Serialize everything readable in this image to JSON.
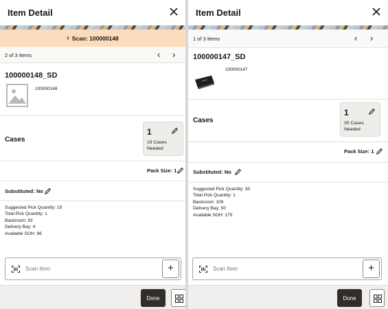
{
  "left": {
    "title": "Item Detail",
    "scan_banner": "Scan: 100000148",
    "pager_text": "2 of 3 Items",
    "item_id": "100000148_SD",
    "upc": "100000148",
    "uom_label": "Cases",
    "qty_value": "1",
    "qty_needed": "19 Cases Needed",
    "pack_size": "Pack Size: 1",
    "substituted": "Substituted: No",
    "details": [
      "Suggested Pick Quantity: 19",
      "Total Pick Quantity: 1",
      "Backroom: 83",
      "Delivery Bay: 4",
      "Available SOH: 96"
    ],
    "scan_placeholder": "Scan Item",
    "done_label": "Done"
  },
  "right": {
    "title": "Item Detail",
    "pager_text": "1 of 3 Items",
    "item_id": "100000147_SD",
    "upc": "100000147",
    "uom_label": "Cases",
    "qty_value": "1",
    "qty_needed": "30 Cases Needed",
    "pack_size": "Pack Size: 1",
    "substituted": "Substituted: No",
    "details": [
      "Suggested Pick Quantity: 30",
      "Total Pick Quantity: 1",
      "Backroom: 109",
      "Delivery Bay: 50",
      "Available SOH: 175"
    ],
    "scan_placeholder": "Scan Item",
    "done_label": "Done"
  },
  "icons": {
    "close": "close-icon",
    "prev": "chevron-left-icon",
    "next": "chevron-right-icon",
    "edit": "pencil-icon",
    "scan": "barcode-scan-icon",
    "add": "plus-icon",
    "grid": "grid-icon",
    "image_placeholder": "image-placeholder-icon"
  },
  "colors": {
    "scan_banner_bg": "#fcdcba",
    "done_button_bg": "#312d2a",
    "qty_card_bg": "#efede9"
  }
}
